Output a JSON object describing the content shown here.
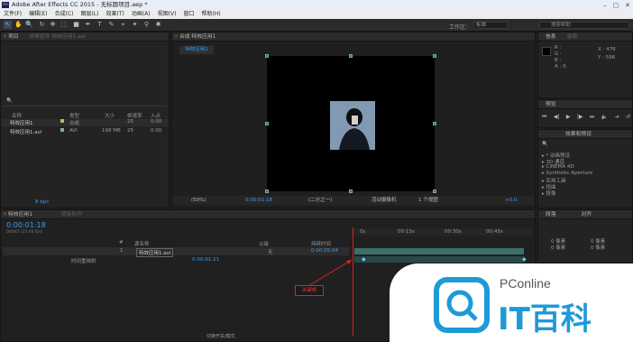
{
  "app": {
    "title": "Adobe After Effects CC 2015 - 无标题项目.aep *",
    "logo_text": "Ae"
  },
  "window_buttons": [
    "–",
    "▢",
    "✕"
  ],
  "menu": [
    "文件(F)",
    "编辑(E)",
    "合成(C)",
    "图层(L)",
    "效果(T)",
    "动画(A)",
    "视图(V)",
    "窗口",
    "帮助(H)"
  ],
  "toolbar": {
    "workspace_label": "工作区：",
    "workspace_value": "标准",
    "search_help": "搜索帮助",
    "tools": [
      "↖",
      "✋",
      "🔍",
      "↻",
      "✥",
      "⬚",
      "■",
      "✒",
      "T",
      "✎",
      "⌖",
      "✦",
      "⚲",
      "✱"
    ]
  },
  "project": {
    "tab": "项目",
    "title_dim": "效果控件 特效应用1.avi",
    "search_icon": "🔍",
    "columns": [
      "名称",
      "类型",
      "大小",
      "帧速率",
      "入点"
    ],
    "rows": [
      {
        "name": "特效应用1",
        "type": "合成",
        "size": "",
        "fps": "25",
        "in": "0:00"
      },
      {
        "name": "特效应用1.avi",
        "type": "AVI",
        "size": "198 MB",
        "fps": "25",
        "in": "0:00"
      }
    ],
    "bpc": "8 bpc"
  },
  "composition": {
    "tab": "合成 特效应用1",
    "sub_tab": "特效应用1",
    "zoom": "(50%)",
    "time": "0:00:01:18",
    "resolution": "(二分之一)",
    "camera": "活动摄像机",
    "views": "1 个视图",
    "exposure": "+0.0"
  },
  "info": {
    "tab1": "信息",
    "tab2": "音频",
    "r": "R :",
    "g": "G :",
    "b": "B :",
    "a": "A : 0",
    "x": "X : 476",
    "y": "Y : 596"
  },
  "preview": {
    "tab": "预览",
    "buttons": [
      "⏮",
      "◀|",
      "▶",
      "|▶",
      "⏭",
      "🔈",
      "⇥",
      "↺"
    ]
  },
  "effects": {
    "tab1": "效果和预设",
    "search_icon": "🔍",
    "items": [
      "* 动画预设",
      "3D 通道",
      "CINEMA 4D",
      "Synthetic Aperture",
      "实用工具",
      "扭曲",
      "抠像"
    ]
  },
  "paragraph": {
    "tab1": "段落",
    "tab2": "对齐",
    "rows": [
      [
        "0 像素",
        "0 像素"
      ],
      [
        "0 像素",
        "0 像素"
      ],
      [
        "0 像素",
        "0 像素"
      ]
    ]
  },
  "timeline": {
    "tab": "特效应用1",
    "tab2": "渲染队列",
    "timecode": "0:00:01:18",
    "frames": "00043 (25.00 fps)",
    "headers": [
      "#",
      "源名称",
      "父级",
      "持续时间"
    ],
    "layer": {
      "num": "1",
      "name": "特效应用1.avi",
      "parent": "无",
      "duration": "0:00:05:04"
    },
    "sublayer": {
      "name": "时间重映射",
      "value": "0:00:01:21"
    },
    "ruler": [
      "0s",
      "00:15s",
      "00:30s",
      "00:45s"
    ],
    "bottom": "切换开关/模式"
  },
  "annotation": "关键帧",
  "watermark": {
    "brand": "PConline",
    "cn": "IT百科"
  }
}
